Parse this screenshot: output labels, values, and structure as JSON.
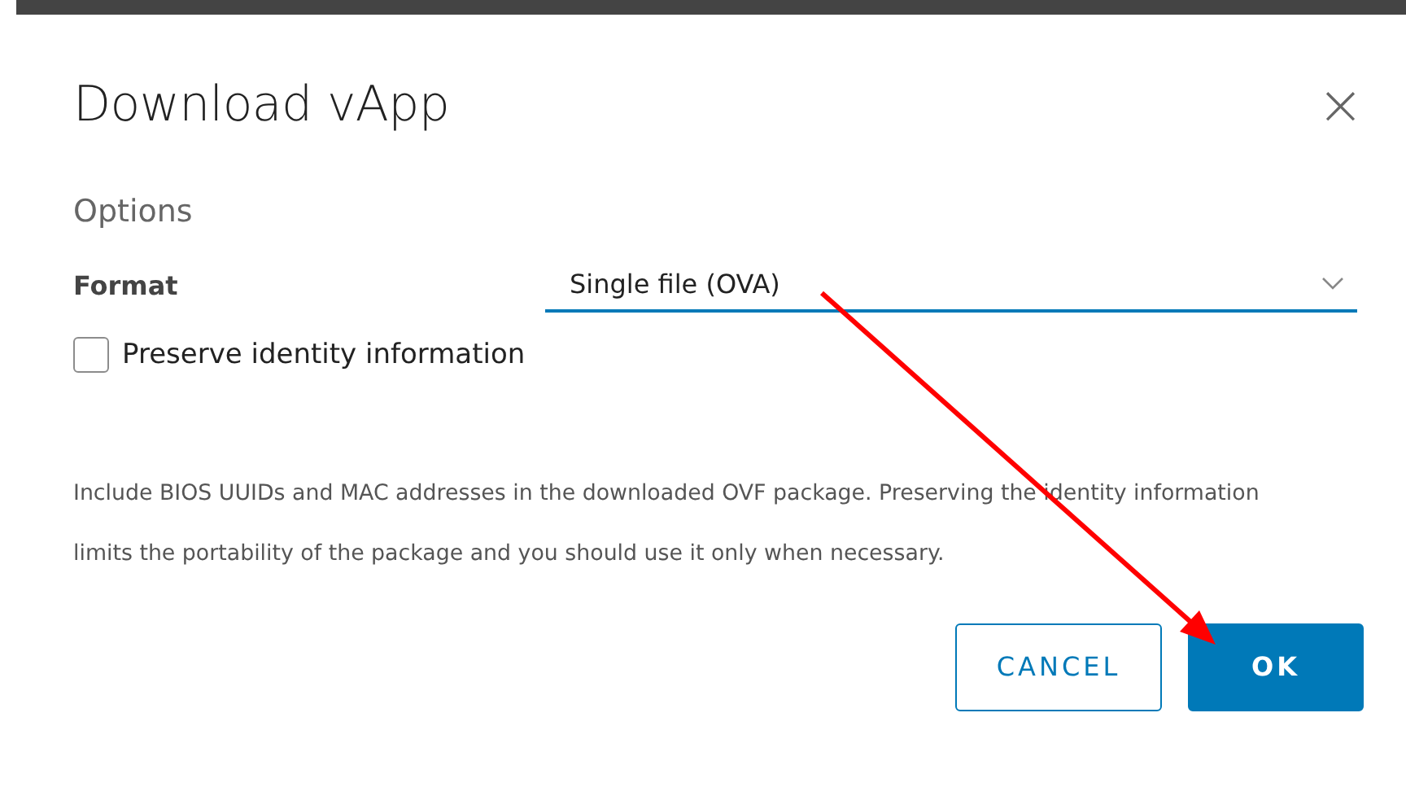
{
  "dialog": {
    "title": "Download vApp",
    "close": "×"
  },
  "section": "Options",
  "format": {
    "label": "Format",
    "value": "Single file (OVA)"
  },
  "preserve": {
    "label": "Preserve identity information",
    "checked": false
  },
  "description": "Include BIOS UUIDs and MAC addresses in the downloaded OVF package. Preserving the identity information limits the portability of the package and you should use it only when necessary.",
  "buttons": [
    {
      "label": "CANCEL",
      "kind": "outline"
    },
    {
      "label": "OK",
      "kind": "primary"
    }
  ]
}
